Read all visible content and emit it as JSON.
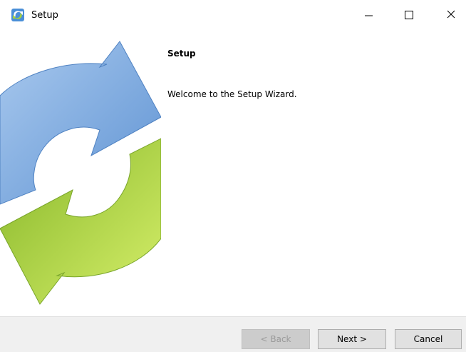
{
  "window": {
    "title": "Setup",
    "icon": "setup-icon",
    "controls": [
      "minimize-icon",
      "maximize-icon",
      "close-icon"
    ]
  },
  "main": {
    "heading": "Setup",
    "welcome_text": "Welcome to the Setup Wizard."
  },
  "side_graphic": {
    "icon": "refresh-arrows-icon",
    "colors": {
      "blue": "#6fa0d9",
      "green": "#9cc93a"
    }
  },
  "buttons": {
    "back_label": "< Back",
    "next_label": "Next >",
    "cancel_label": "Cancel"
  }
}
